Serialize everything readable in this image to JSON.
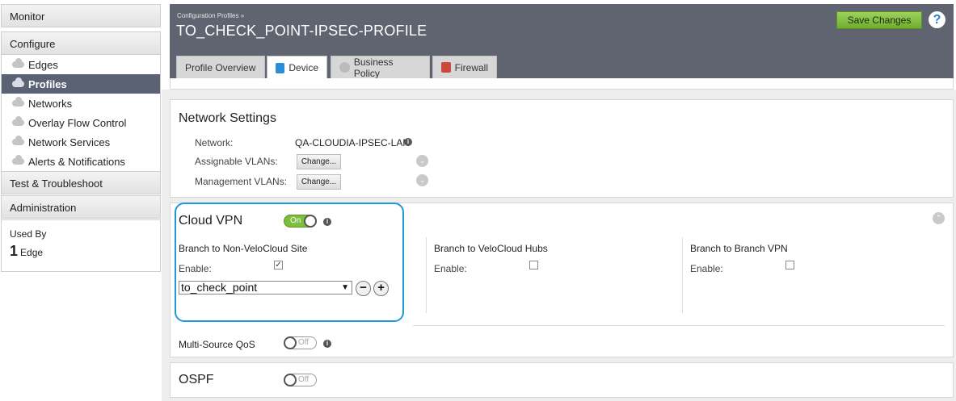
{
  "sidebar": {
    "monitor": "Monitor",
    "configure": "Configure",
    "items": [
      {
        "label": "Edges"
      },
      {
        "label": "Profiles"
      },
      {
        "label": "Networks"
      },
      {
        "label": "Overlay Flow Control"
      },
      {
        "label": "Network Services"
      },
      {
        "label": "Alerts & Notifications"
      }
    ],
    "test": "Test & Troubleshoot",
    "administration": "Administration",
    "used_by_label": "Used By",
    "used_by_count": "1",
    "used_by_unit": "Edge"
  },
  "header": {
    "breadcrumb": "Configuration Profiles »",
    "title": "TO_CHECK_POINT-IPSEC-PROFILE",
    "save_label": "Save Changes",
    "help": "?"
  },
  "tabs": [
    {
      "label": "Profile Overview"
    },
    {
      "label": "Device"
    },
    {
      "label": "Business Policy"
    },
    {
      "label": "Firewall"
    }
  ],
  "network_settings": {
    "title": "Network Settings",
    "network_label": "Network:",
    "network_value": "QA-CLOUDIA-IPSEC-LAN",
    "assignable_label": "Assignable VLANs:",
    "management_label": "Management VLANs:",
    "change_label": "Change..."
  },
  "cloud_vpn": {
    "title": "Cloud VPN",
    "toggle": "On",
    "non_velo_title": "Branch to Non-VeloCloud Site",
    "enable_label": "Enable:",
    "non_velo_enabled": true,
    "select_value": "to_check_point",
    "hubs_title": "Branch to VeloCloud Hubs",
    "hubs_enabled": false,
    "b2b_title": "Branch to Branch VPN",
    "b2b_enabled": false,
    "qos_label": "Multi-Source QoS",
    "qos_toggle": "Off"
  },
  "ospf": {
    "title": "OSPF",
    "toggle": "Off"
  },
  "colors": {
    "header_bg": "#5f6470",
    "active_item": "#5a6273",
    "save_green": "#7bbf3a",
    "highlight": "#1e9ad6"
  }
}
